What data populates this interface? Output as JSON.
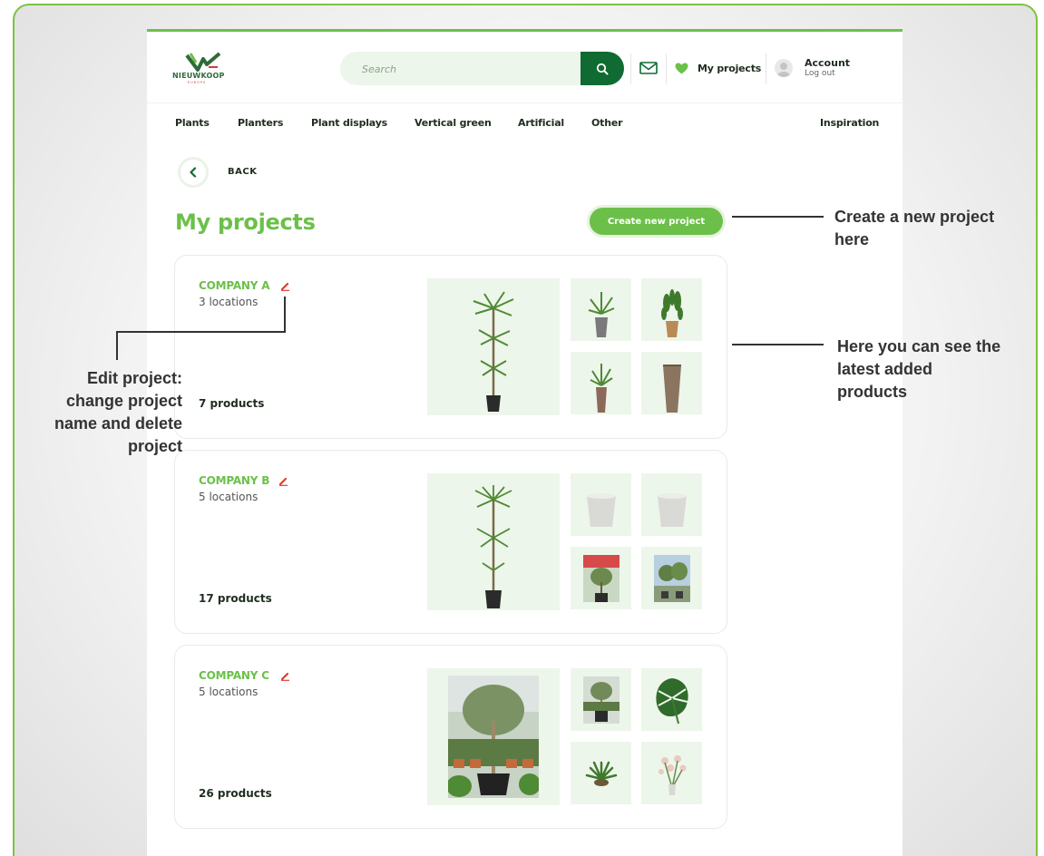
{
  "header": {
    "logo_text": "NIEUWKOOP",
    "logo_sub": "EUROPE",
    "search": {
      "placeholder": "Search"
    },
    "my_projects_label": "My projects",
    "account_title": "Account",
    "account_sub": "Log out"
  },
  "nav": {
    "items": [
      "Plants",
      "Planters",
      "Plant displays",
      "Vertical green",
      "Artificial",
      "Other"
    ],
    "right_item": "Inspiration"
  },
  "back_label": "BACK",
  "page_title": "My projects",
  "create_button_label": "Create new project",
  "projects": [
    {
      "name": "COMPANY A",
      "locations": "3 locations",
      "products": "7 products"
    },
    {
      "name": "COMPANY B",
      "locations": "5 locations",
      "products": "17 products"
    },
    {
      "name": "COMPANY C",
      "locations": "5 locations",
      "products": "26 products"
    }
  ],
  "annotations": {
    "create_line1": "Create a new project",
    "create_line2": "here",
    "latest_line1": "Here you can see the",
    "latest_line2": "latest added",
    "latest_line3": "products",
    "edit_line1": "Edit project:",
    "edit_line2": "change project",
    "edit_line3": "name and delete",
    "edit_line4": "project"
  },
  "colors": {
    "brand_green": "#6cc04a",
    "dark_green": "#0f6b32",
    "frame_green": "#7dc242",
    "edit_red": "#e23b2f",
    "tile_bg": "#edf6ea"
  },
  "icons": [
    "search-icon",
    "mail-icon",
    "heart-icon",
    "avatar-icon",
    "chevron-left-icon",
    "pencil-icon"
  ]
}
